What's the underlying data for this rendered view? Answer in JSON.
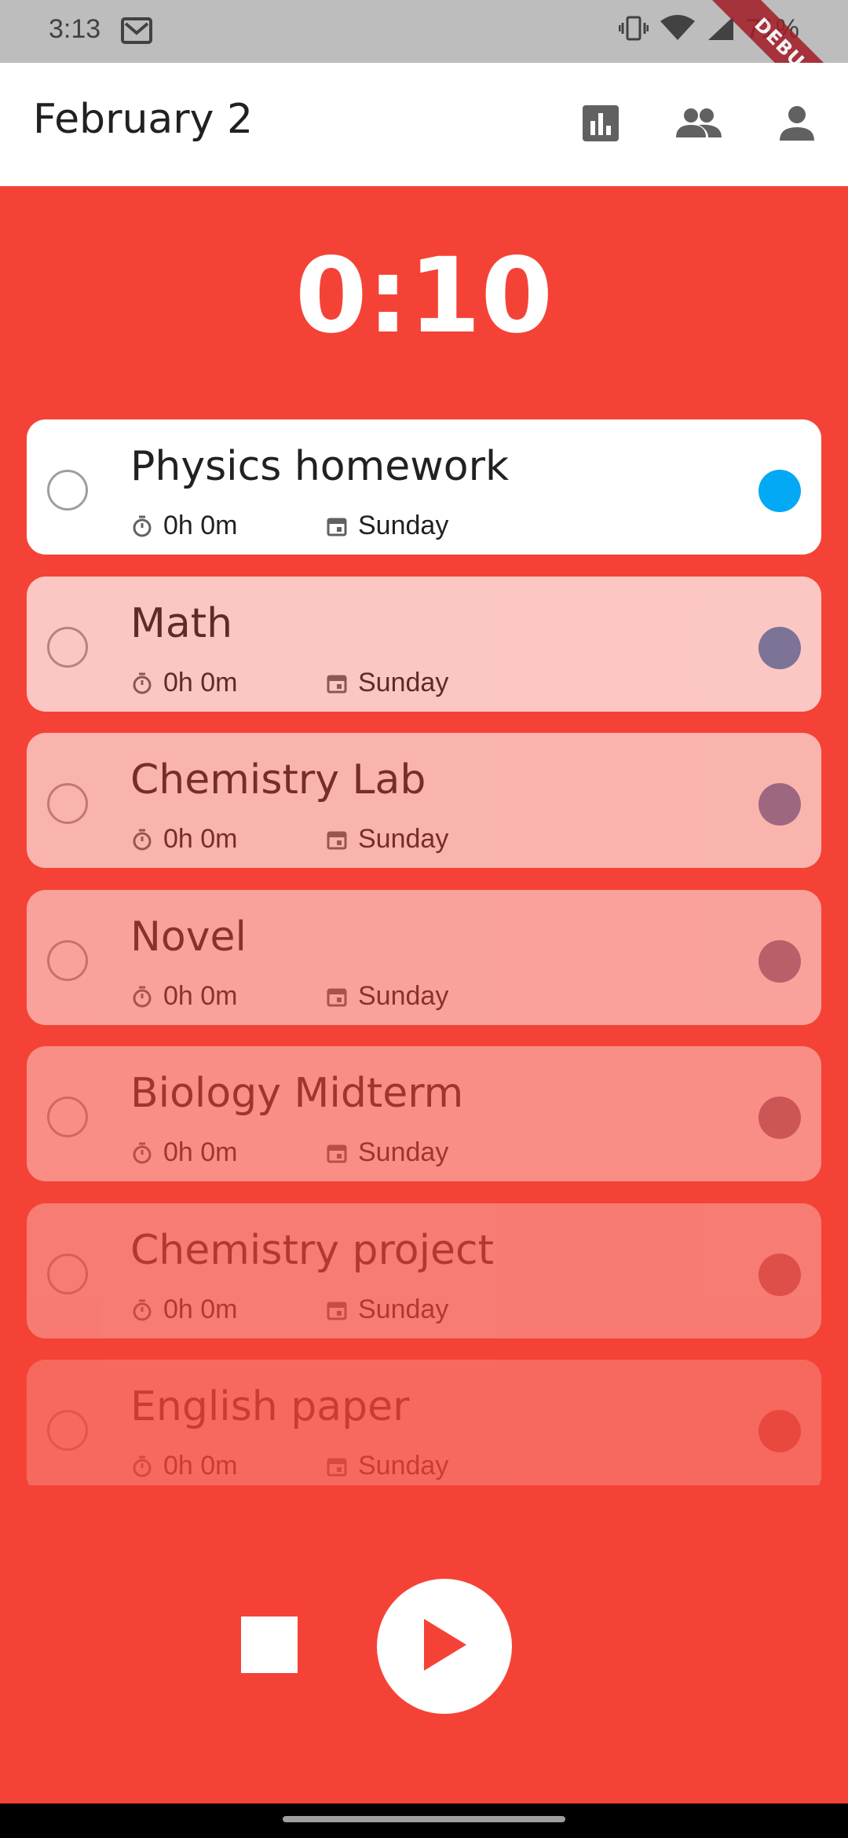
{
  "status_bar": {
    "time": "3:13",
    "battery": "71%"
  },
  "debug_ribbon": "DEBUG",
  "app_bar": {
    "title": "February 2",
    "icons": [
      "stats-icon",
      "groups-icon",
      "person-icon"
    ]
  },
  "timer": {
    "display": "0:10"
  },
  "tasks": [
    {
      "title": "Physics homework",
      "duration": "0h 0m",
      "day": "Sunday",
      "dot_color": "#03a9f4"
    },
    {
      "title": "Math",
      "duration": "0h 0m",
      "day": "Sunday",
      "dot_color": "#4a88c0"
    },
    {
      "title": "Chemistry Lab",
      "duration": "0h 0m",
      "day": "Sunday",
      "dot_color": "#6581b0"
    },
    {
      "title": "Novel",
      "duration": "0h 0m",
      "day": "Sunday",
      "dot_color": "#7f7b9c"
    },
    {
      "title": "Biology Midterm",
      "duration": "0h 0m",
      "day": "Sunday",
      "dot_color": "#937487"
    },
    {
      "title": "Chemistry project",
      "duration": "0h 0m",
      "day": "Sunday",
      "dot_color": "#a96c74"
    },
    {
      "title": "English paper",
      "duration": "0h 0m",
      "day": "Sunday",
      "dot_color": "#c06060"
    }
  ],
  "colors": {
    "accent": "#f44336",
    "card_active": "#ffffff"
  },
  "controls": {
    "stop_icon": "stop-icon",
    "play_icon": "play-icon"
  }
}
